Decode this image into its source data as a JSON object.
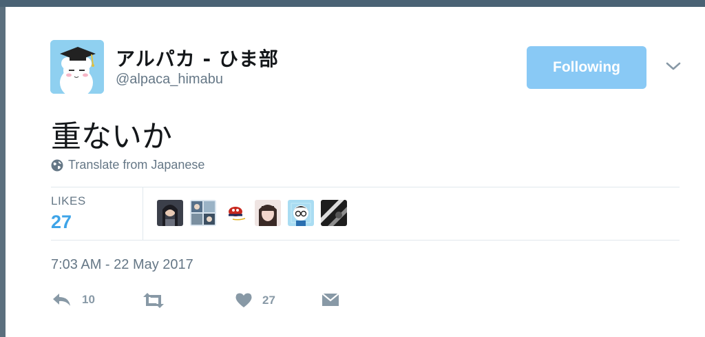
{
  "colors": {
    "accent": "#3ea4e8",
    "follow_button_bg": "#89c9f5",
    "muted_text": "#657786",
    "icon": "#8899a6"
  },
  "user": {
    "display_name": "アルパカ - ひま部",
    "screen_name": "@alpaca_himabu",
    "avatar_icon": "alpaca-graduation-cap-avatar"
  },
  "follow_button": {
    "label": "Following"
  },
  "tweet": {
    "text": "重ないか",
    "translate_label": "Translate from Japanese",
    "timestamp": "7:03 AM - 22 May 2017"
  },
  "stats": {
    "likes_label": "LIKES",
    "likes_count": "27",
    "likers": [
      {
        "name": "liker-avatar-1"
      },
      {
        "name": "liker-avatar-2"
      },
      {
        "name": "liker-avatar-3"
      },
      {
        "name": "liker-avatar-4"
      },
      {
        "name": "liker-avatar-5"
      },
      {
        "name": "liker-avatar-6"
      }
    ]
  },
  "actions": {
    "reply_count": "10",
    "retweet_count": "",
    "like_count": "27",
    "icons": [
      "reply-icon",
      "retweet-icon",
      "heart-icon",
      "direct-message-icon"
    ]
  }
}
